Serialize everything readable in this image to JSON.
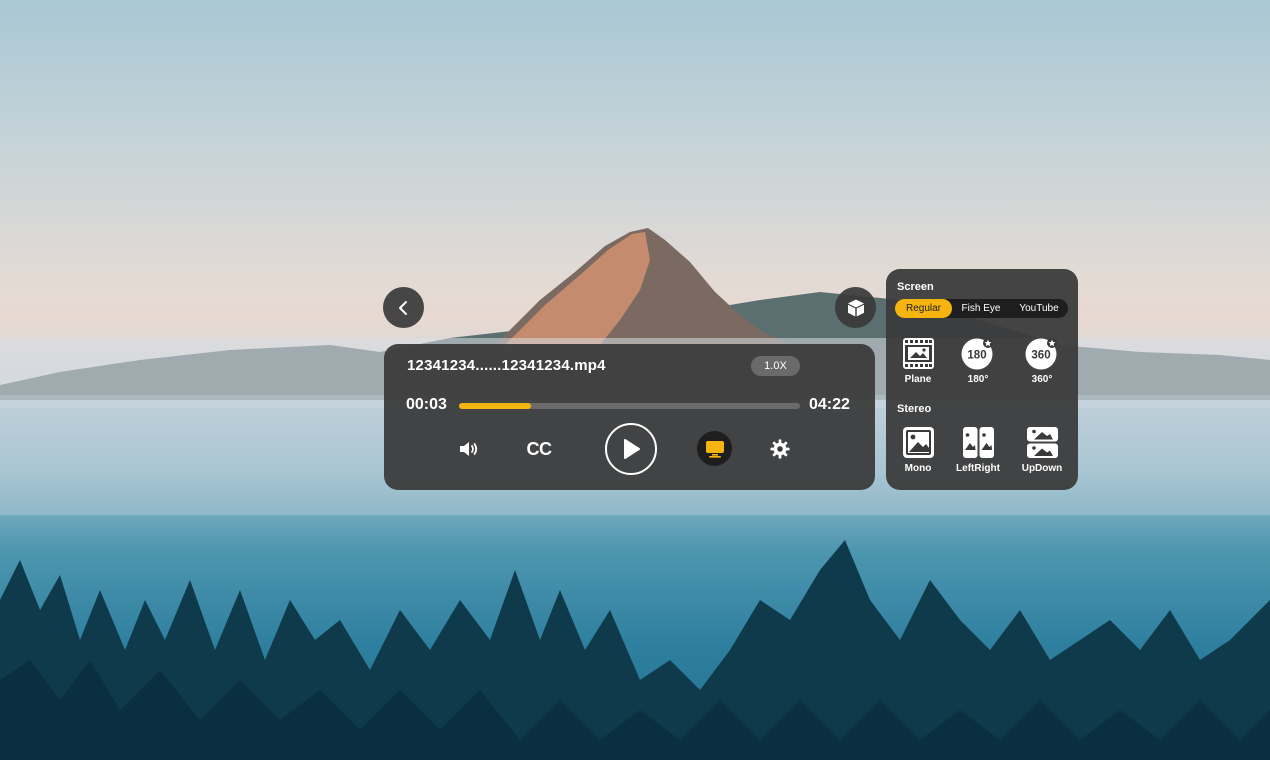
{
  "player": {
    "file_name": "12341234......12341234.mp4",
    "speed": "1.0X",
    "current_time": "00:03",
    "duration": "04:22",
    "progress": 0.21,
    "cc_label": "CC",
    "accent_color": "#f5b40f"
  },
  "screen_panel": {
    "screen_title": "Screen",
    "tabs": [
      {
        "label": "Regular",
        "active": true
      },
      {
        "label": "Fish Eye",
        "active": false
      },
      {
        "label": "YouTube",
        "active": false
      }
    ],
    "screen_options": [
      {
        "icon": "film-icon",
        "label": "Plane"
      },
      {
        "icon": "180-icon",
        "label": "180°",
        "badge": "180"
      },
      {
        "icon": "360-icon",
        "label": "360°",
        "badge": "360"
      }
    ],
    "stereo_title": "Stereo",
    "stereo_options": [
      {
        "icon": "image-icon",
        "label": "Mono"
      },
      {
        "icon": "split-left-right-icon",
        "label": "LeftRight"
      },
      {
        "icon": "split-up-down-icon",
        "label": "UpDown"
      }
    ]
  }
}
